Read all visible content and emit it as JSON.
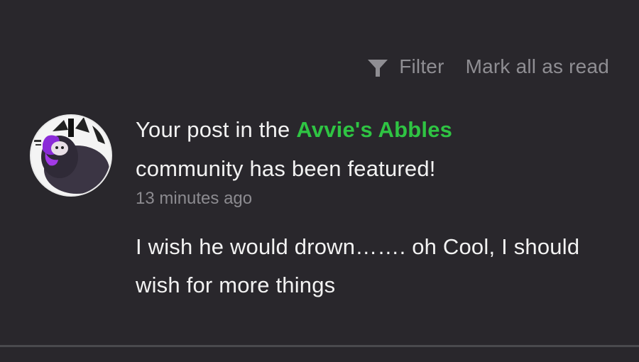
{
  "toolbar": {
    "filter_label": "Filter",
    "mark_all_label": "Mark all as read",
    "icon": "filter-funnel-icon"
  },
  "notification": {
    "avatar_icon": "user-avatar",
    "title_prefix": "Your post in the ",
    "community_name": "Avvie's Abbles",
    "title_suffix": "community has been featured!",
    "timestamp": "13 minutes ago",
    "message": "I wish he would drown……. oh Cool, I should wish for more things"
  },
  "colors": {
    "background": "#29272c",
    "accent_green": "#2fc443",
    "muted_text": "#8f8e93",
    "primary_text": "#f2f2f2"
  }
}
